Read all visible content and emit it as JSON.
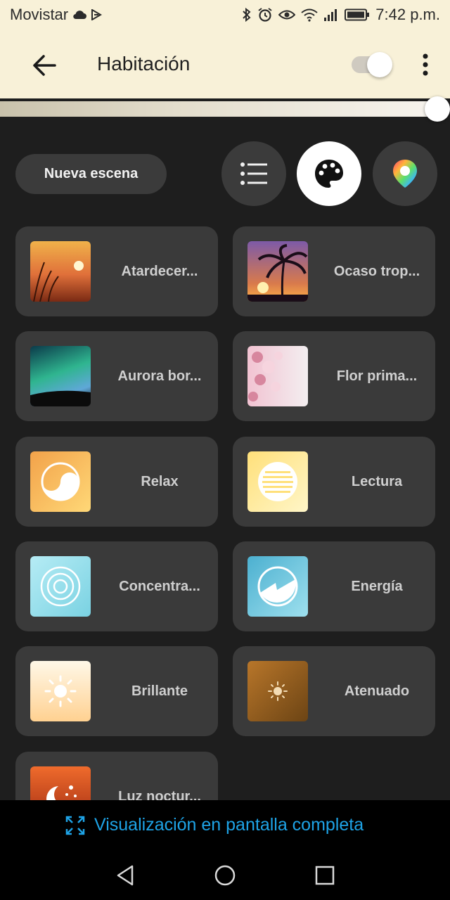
{
  "status_bar": {
    "carrier": "Movistar",
    "time": "7:42 p.m.",
    "icons": [
      "cloud-icon",
      "download-icon",
      "bluetooth-icon",
      "alarm-icon",
      "eye-icon",
      "wifi-icon",
      "signal-icon",
      "battery-icon"
    ]
  },
  "app_bar": {
    "title": "Habitación",
    "power_on": true,
    "brightness_level": 1.0
  },
  "actions": {
    "new_scene_label": "Nueva escena",
    "views": [
      "list-view",
      "palette-view",
      "color-picker-view"
    ],
    "active_view": "palette-view"
  },
  "scenes": [
    {
      "label": "Atardecer...",
      "icon": "sunset-photo",
      "colors": [
        "#f0b24a",
        "#e0703a",
        "#7a2a14"
      ]
    },
    {
      "label": "Ocaso trop...",
      "icon": "tropical-palm-photo",
      "colors": [
        "#7d5aa8",
        "#d87a4c",
        "#ffb347"
      ]
    },
    {
      "label": "Aurora bor...",
      "icon": "aurora-photo",
      "colors": [
        "#0b3a4a",
        "#2fb58f",
        "#5fa8d8"
      ]
    },
    {
      "label": "Flor prima...",
      "icon": "cherry-blossom-photo",
      "colors": [
        "#f2c3d2",
        "#d7869e",
        "#f3eef0"
      ]
    },
    {
      "label": "Relax",
      "icon": "relax-icon",
      "colors": [
        "#f2a24a",
        "#ffd877"
      ]
    },
    {
      "label": "Lectura",
      "icon": "reading-icon",
      "colors": [
        "#ffe07a",
        "#fff6c8"
      ]
    },
    {
      "label": "Concentra...",
      "icon": "concentrate-icon",
      "colors": [
        "#b6ecf5",
        "#7ad2e2"
      ]
    },
    {
      "label": "Energía",
      "icon": "energize-icon",
      "colors": [
        "#4cb0d0",
        "#9ee0ee"
      ]
    },
    {
      "label": "Brillante",
      "icon": "bright-sun-icon",
      "colors": [
        "#fff8e8",
        "#ffd191"
      ]
    },
    {
      "label": "Atenuado",
      "icon": "dimmed-sun-icon",
      "colors": [
        "#b8762a",
        "#6c4414"
      ]
    },
    {
      "label": "Luz noctur...",
      "icon": "nightlight-icon",
      "colors": [
        "#ef6b2c",
        "#9e2a12"
      ]
    }
  ],
  "footer": {
    "fullscreen_label": "Visualización en pantalla completa"
  },
  "colors": {
    "header_bg": "#f8f1d8",
    "page_bg": "#1e1e1e",
    "card_bg": "#3a3a3a",
    "accent_link": "#1ea3e6"
  }
}
